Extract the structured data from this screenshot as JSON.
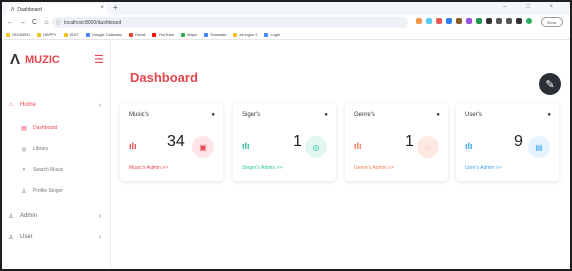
{
  "browser": {
    "tab_title": "Dashboard",
    "tab_close": "×",
    "new_tab": "+",
    "window_controls": "– □ ×",
    "url": "localhost:8000/dashboard",
    "profile_label": "Error",
    "bookmarks": [
      {
        "label": "ODOMED",
        "color": "#f0c419"
      },
      {
        "label": "HAPPY",
        "color": "#f0c419"
      },
      {
        "label": "EDIT",
        "color": "#f0c419"
      },
      {
        "label": "Google Calendar",
        "color": "#4285f4"
      },
      {
        "label": "Gmail",
        "color": "#ea4335"
      },
      {
        "label": "YouTube",
        "color": "#ff0000"
      },
      {
        "label": "Maps",
        "color": "#34a853"
      },
      {
        "label": "Translate",
        "color": "#4285f4"
      },
      {
        "label": "all logos 2",
        "color": "#fbbc05"
      },
      {
        "label": "Login",
        "color": "#4285f4"
      }
    ]
  },
  "sidebar": {
    "brand": "MUZIC",
    "items": [
      {
        "label": "Home",
        "icon": "home-icon",
        "glyph": "⌂"
      },
      {
        "label": "Dashboard",
        "icon": "grid-icon",
        "glyph": "▤"
      },
      {
        "label": "Library",
        "icon": "disc-icon",
        "glyph": "◎"
      },
      {
        "label": "Search Music",
        "icon": "search-icon",
        "glyph": "⌕"
      },
      {
        "label": "Profile Singer",
        "icon": "user-icon",
        "glyph": "♙"
      },
      {
        "label": "Admin",
        "icon": "users-icon",
        "glyph": "♙"
      },
      {
        "label": "User",
        "icon": "user-icon",
        "glyph": "♙"
      }
    ],
    "chevron_right": "›",
    "chevron_down": "›"
  },
  "main": {
    "title": "Dashboard",
    "cards": [
      {
        "title": "Music's",
        "value": "34",
        "link": "Music's Admin >>",
        "accent": "#e8464f",
        "circle_bg": "#fde4e6",
        "circle_glyph": "▣"
      },
      {
        "title": "Siger's",
        "value": "1",
        "link": "Singer's Admin >>",
        "accent": "#2ec4a0",
        "circle_bg": "#e2f7f1",
        "circle_glyph": "◎"
      },
      {
        "title": "Genre's",
        "value": "1",
        "link": "Genre's Admin >>",
        "accent": "#f27a54",
        "circle_bg": "#fde9e2",
        "circle_glyph": "◌"
      },
      {
        "title": "User's",
        "value": "9",
        "link": "User's Admin >>",
        "accent": "#3aa6e8",
        "circle_bg": "#e6f3fc",
        "circle_glyph": "▤"
      }
    ]
  }
}
